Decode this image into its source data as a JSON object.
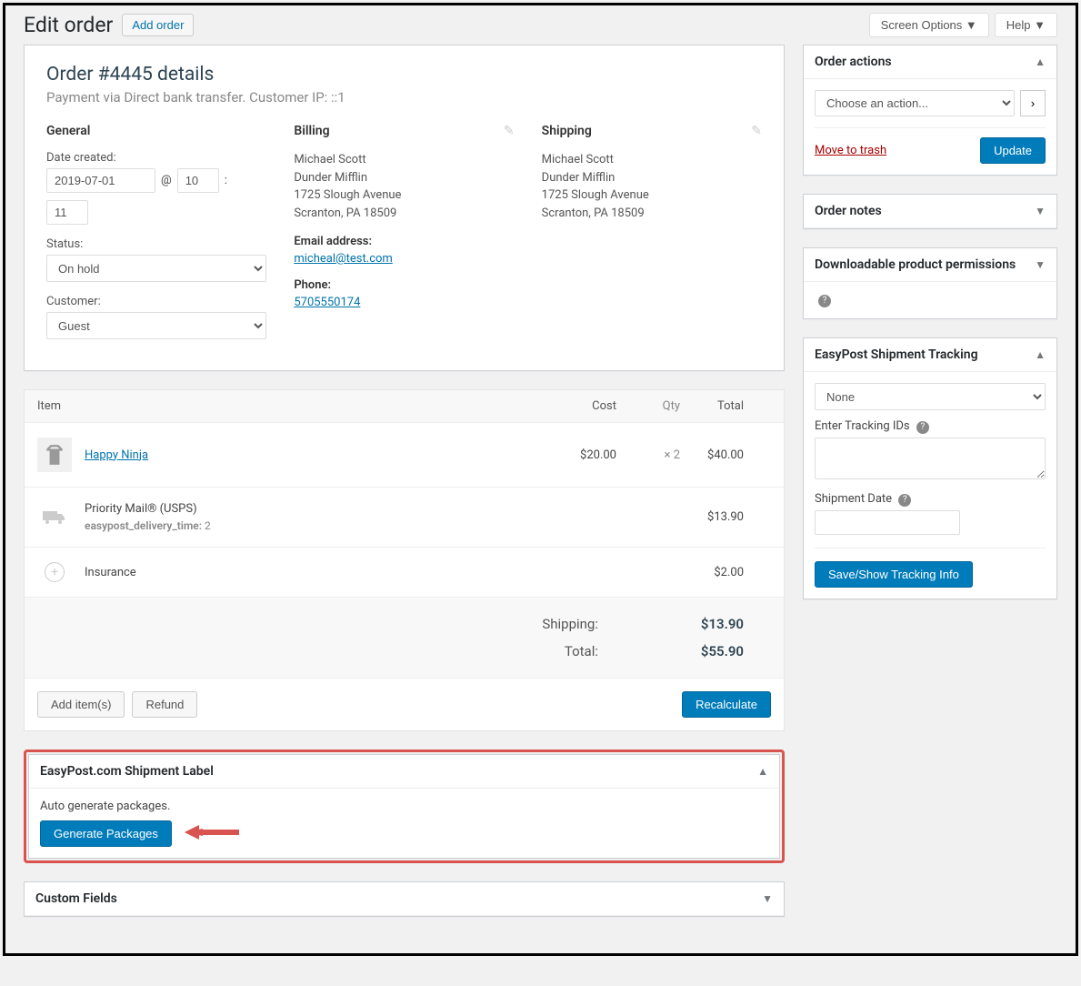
{
  "top": {
    "screen_options": "Screen Options ▼",
    "help": "Help ▼"
  },
  "page": {
    "title": "Edit order",
    "add_order": "Add order"
  },
  "order": {
    "title": "Order #4445 details",
    "subtitle": "Payment via Direct bank transfer. Customer IP: ::1"
  },
  "general": {
    "heading": "General",
    "date_label": "Date created:",
    "date": "2019-07-01",
    "at": "@",
    "hour": "10",
    "colon": ":",
    "minute": "11",
    "status_label": "Status:",
    "status": "On hold",
    "customer_label": "Customer:",
    "customer": "Guest"
  },
  "billing": {
    "heading": "Billing",
    "name": "Michael Scott",
    "company": "Dunder Mifflin",
    "street": "1725 Slough Avenue",
    "city": "Scranton, PA 18509",
    "email_label": "Email address:",
    "email": "micheal@test.com",
    "phone_label": "Phone:",
    "phone": "5705550174"
  },
  "shipping": {
    "heading": "Shipping",
    "name": "Michael Scott",
    "company": "Dunder Mifflin",
    "street": "1725 Slough Avenue",
    "city": "Scranton, PA 18509"
  },
  "items": {
    "header_item": "Item",
    "header_cost": "Cost",
    "header_qty": "Qty",
    "header_total": "Total",
    "product_name": "Happy Ninja",
    "product_cost": "$20.00",
    "product_qty": "× 2",
    "product_total": "$40.00",
    "shipping_name": "Priority Mail® (USPS)",
    "shipping_meta_key": "easypost_delivery_time:",
    "shipping_meta_val": "2",
    "shipping_total": "$13.90",
    "insurance_name": "Insurance",
    "insurance_total": "$2.00"
  },
  "totals": {
    "shipping_label": "Shipping:",
    "shipping_val": "$13.90",
    "total_label": "Total:",
    "total_val": "$55.90"
  },
  "item_actions": {
    "add_items": "Add item(s)",
    "refund": "Refund",
    "recalculate": "Recalculate"
  },
  "easypost_label": {
    "title": "EasyPost.com Shipment Label",
    "auto_text": "Auto generate packages.",
    "generate_btn": "Generate Packages"
  },
  "custom_fields": {
    "title": "Custom Fields"
  },
  "side_actions": {
    "title": "Order actions",
    "choose": "Choose an action...",
    "trash": "Move to trash",
    "update": "Update"
  },
  "side_notes": {
    "title": "Order notes"
  },
  "side_downloads": {
    "title": "Downloadable product permissions"
  },
  "side_tracking": {
    "title": "EasyPost Shipment Tracking",
    "none": "None",
    "ids_label": "Enter Tracking IDs",
    "date_label": "Shipment Date",
    "save_btn": "Save/Show Tracking Info"
  }
}
